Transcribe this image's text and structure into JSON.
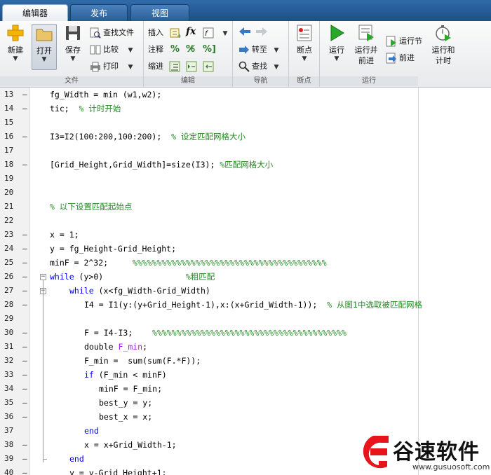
{
  "tabs": [
    {
      "label": "编辑器",
      "active": true
    },
    {
      "label": "发布",
      "active": false
    },
    {
      "label": "视图",
      "active": false
    }
  ],
  "ribbon": {
    "groups": {
      "file": "文件",
      "edit": "编辑",
      "nav": "导航",
      "breakpoints": "断点",
      "run": "运行"
    },
    "file": {
      "new": "新建",
      "open": "打开",
      "save": "保存",
      "find_files": "查找文件",
      "compare": "比较",
      "print": "打印"
    },
    "edit": {
      "insert": "插入",
      "fx": "fx",
      "comment": "注释",
      "indent": "缩进"
    },
    "nav": {
      "goto": "转至",
      "find": "查找"
    },
    "breakpoints": {
      "label": "断点"
    },
    "run": {
      "run": "运行",
      "run_advance": "运行并\n前进",
      "run_section": "运行节",
      "advance": "前进",
      "run_time": "运行和\n计时"
    }
  },
  "colors": {
    "keyword": "#0000ff",
    "comment": "#228b22",
    "string_var": "#a020f0",
    "watermark_red": "#e8141c"
  },
  "code_lines": [
    {
      "n": "13",
      "dash": true,
      "indent": 0,
      "tokens": [
        {
          "t": "fg_Width = min (w1,w2);",
          "c": ""
        }
      ]
    },
    {
      "n": "14",
      "dash": true,
      "indent": 0,
      "tokens": [
        {
          "t": "tic;  ",
          "c": ""
        },
        {
          "t": "% 计时开始",
          "c": "cm"
        }
      ]
    },
    {
      "n": "15",
      "dash": false,
      "indent": 0,
      "tokens": []
    },
    {
      "n": "16",
      "dash": true,
      "indent": 0,
      "tokens": [
        {
          "t": "I3=I2(100:200,100:200);  ",
          "c": ""
        },
        {
          "t": "% 设定匹配网格大小",
          "c": "cm"
        }
      ]
    },
    {
      "n": "17",
      "dash": false,
      "indent": 0,
      "tokens": []
    },
    {
      "n": "18",
      "dash": true,
      "indent": 0,
      "tokens": [
        {
          "t": "[Grid_Height,Grid_Width]=size(I3); ",
          "c": ""
        },
        {
          "t": "%匹配网格大小",
          "c": "cm"
        }
      ]
    },
    {
      "n": "19",
      "dash": false,
      "indent": 0,
      "tokens": []
    },
    {
      "n": "20",
      "dash": false,
      "indent": 0,
      "tokens": []
    },
    {
      "n": "21",
      "dash": false,
      "indent": 0,
      "tokens": [
        {
          "t": "% 以下设置匹配起始点",
          "c": "cm"
        }
      ]
    },
    {
      "n": "22",
      "dash": false,
      "indent": 0,
      "tokens": []
    },
    {
      "n": "23",
      "dash": true,
      "indent": 0,
      "tokens": [
        {
          "t": "x = 1;",
          "c": ""
        }
      ]
    },
    {
      "n": "24",
      "dash": true,
      "indent": 0,
      "tokens": [
        {
          "t": "y = fg_Height-Grid_Height;",
          "c": ""
        }
      ]
    },
    {
      "n": "25",
      "dash": true,
      "indent": 0,
      "tokens": [
        {
          "t": "minF = 2^32;     ",
          "c": ""
        },
        {
          "t": "%%%%%%%%%%%%%%%%%%%%%%%%%%%%%%%%%%%%%%%%",
          "c": "cm"
        }
      ]
    },
    {
      "n": "26",
      "dash": true,
      "indent": 0,
      "fold": true,
      "tokens": [
        {
          "t": "while",
          "c": "kw"
        },
        {
          "t": " (y>0)                 ",
          "c": ""
        },
        {
          "t": "%粗匹配",
          "c": "cm"
        }
      ]
    },
    {
      "n": "27",
      "dash": true,
      "indent": 1,
      "fold": true,
      "tokens": [
        {
          "t": "while",
          "c": "kw"
        },
        {
          "t": " (x<fg_Width-Grid_Width)",
          "c": ""
        }
      ]
    },
    {
      "n": "28",
      "dash": true,
      "indent": 2,
      "tokens": [
        {
          "t": "I4 = I1(y:(y+Grid_Height-1),x:(x+Grid_Width-1));  ",
          "c": ""
        },
        {
          "t": "% 从图1中选取被匹配网格",
          "c": "cm"
        }
      ]
    },
    {
      "n": "29",
      "dash": false,
      "indent": 2,
      "tokens": []
    },
    {
      "n": "30",
      "dash": true,
      "indent": 2,
      "tokens": [
        {
          "t": "F = I4-I3;    ",
          "c": ""
        },
        {
          "t": "%%%%%%%%%%%%%%%%%%%%%%%%%%%%%%%%%%%%%%%%",
          "c": "cm"
        }
      ]
    },
    {
      "n": "31",
      "dash": true,
      "indent": 2,
      "tokens": [
        {
          "t": "double ",
          "c": ""
        },
        {
          "t": "F_min",
          "c": "pu"
        },
        {
          "t": ";",
          "c": ""
        }
      ]
    },
    {
      "n": "32",
      "dash": true,
      "indent": 2,
      "tokens": [
        {
          "t": "F_min =  sum(sum(F.*F));",
          "c": ""
        }
      ]
    },
    {
      "n": "33",
      "dash": true,
      "indent": 2,
      "tokens": [
        {
          "t": "if",
          "c": "kw"
        },
        {
          "t": " (F_min < minF)",
          "c": ""
        }
      ]
    },
    {
      "n": "34",
      "dash": true,
      "indent": 3,
      "tokens": [
        {
          "t": "minF = F_min;",
          "c": ""
        }
      ]
    },
    {
      "n": "35",
      "dash": true,
      "indent": 3,
      "tokens": [
        {
          "t": "best_y = y;",
          "c": ""
        }
      ]
    },
    {
      "n": "36",
      "dash": true,
      "indent": 3,
      "tokens": [
        {
          "t": "best_x = x;",
          "c": ""
        }
      ]
    },
    {
      "n": "37",
      "dash": false,
      "indent": 2,
      "tokens": [
        {
          "t": "end",
          "c": "kw"
        }
      ]
    },
    {
      "n": "38",
      "dash": true,
      "indent": 2,
      "tokens": [
        {
          "t": "x = x+Grid_Width-1;",
          "c": ""
        }
      ]
    },
    {
      "n": "39",
      "dash": true,
      "indent": 1,
      "tokens": [
        {
          "t": "end",
          "c": "kw"
        }
      ]
    },
    {
      "n": "40",
      "dash": true,
      "indent": 1,
      "tokens": [
        {
          "t": "y = y-Grid_Height+1;",
          "c": ""
        }
      ]
    }
  ],
  "watermark": {
    "brand": "谷速软件",
    "url": "www.gusuosoft.com"
  }
}
